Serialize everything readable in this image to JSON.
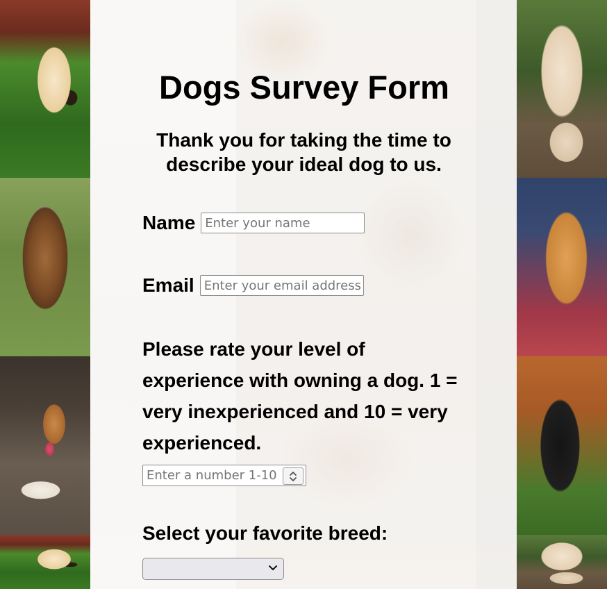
{
  "form": {
    "title": "Dogs Survey Form",
    "description": "Thank you for taking the time to describe your ideal dog to us.",
    "name_label": "Name",
    "name_placeholder": "Enter your name",
    "email_label": "Email",
    "email_placeholder": "Enter your email address",
    "rating_label": "Please rate your level of experience with owning a dog. 1 = very inexperienced and 10 = very experienced.",
    "rating_placeholder": "Enter a number 1-10",
    "breed_label": "Select your favorite breed:",
    "breed_selected": ""
  },
  "background": {
    "tiles": [
      "puppy-photo",
      "yorkie-photo",
      "beagle-photo",
      "poodle-photo",
      "pomeranian-photo",
      "newfoundland-photo"
    ]
  },
  "icons": {
    "spinner": "spinner-arrows-icon",
    "select": "chevron-down-icon"
  }
}
